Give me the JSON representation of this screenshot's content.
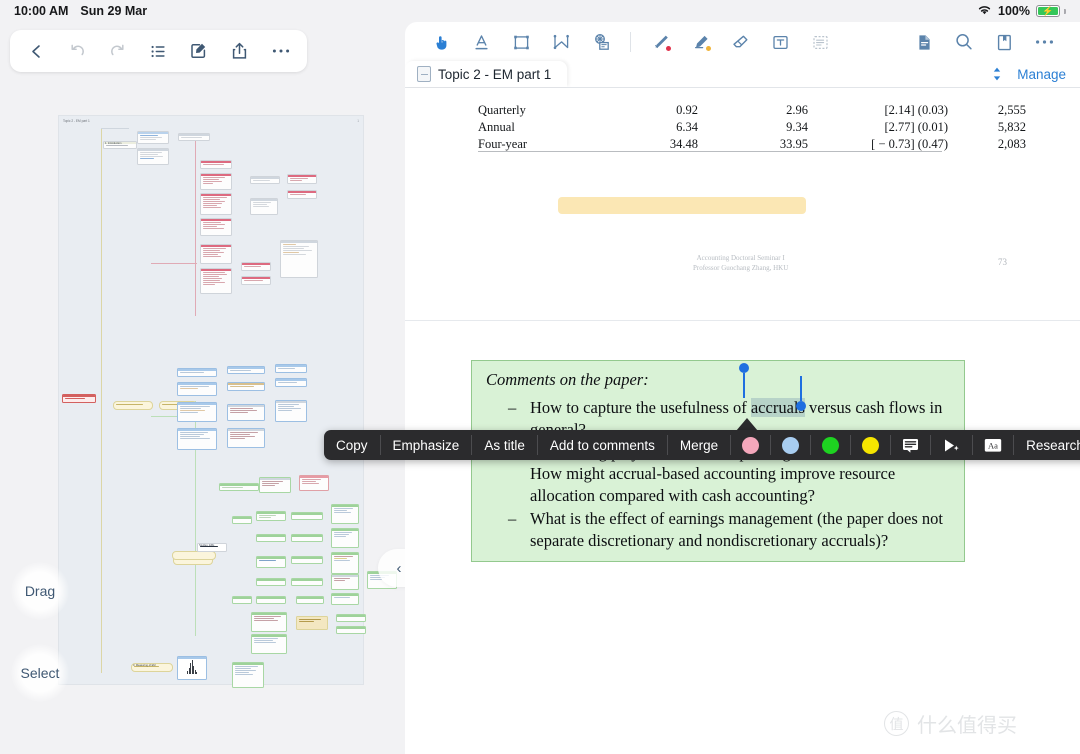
{
  "status_bar": {
    "time": "10:00 AM",
    "date": "Sun 29 Mar",
    "battery_percent": "100%",
    "wifi_icon": "wifi-icon",
    "battery_icon": "battery-charging-icon"
  },
  "left_pane": {
    "toolbar": [
      {
        "name": "back-button",
        "icon": "chevron-left-icon",
        "enabled": true
      },
      {
        "name": "undo-button",
        "icon": "undo-icon",
        "enabled": false
      },
      {
        "name": "redo-button",
        "icon": "redo-icon",
        "enabled": false
      },
      {
        "name": "outline-button",
        "icon": "list-icon",
        "enabled": true
      },
      {
        "name": "edit-button",
        "icon": "edit-square-icon",
        "enabled": true
      },
      {
        "name": "share-button",
        "icon": "share-icon",
        "enabled": true
      },
      {
        "name": "more-button",
        "icon": "ellipsis-icon",
        "enabled": true
      }
    ],
    "mindmap": {
      "title": "Topic 2 - EM part 1",
      "corner": "1",
      "node_labels": [
        "1. Introduction",
        "Earnings Management (EM)",
        "Chapter 1: What is EM",
        "How to do earnings mgmt",
        "Studies: EMs",
        "3. Measuring of EM"
      ],
      "accent_red": "#d9566b",
      "accent_yellow": "#e3c75a",
      "accent_blue": "#7aa8d8",
      "accent_green": "#8ed08a",
      "canvas_bg": "#e9edf2"
    },
    "drag_button": "Drag",
    "select_button": "Select",
    "page_nav": {
      "prev": "‹",
      "next": "›"
    }
  },
  "right_pane": {
    "toolbar_left": [
      {
        "name": "select-tool",
        "icon": "hand-pointer-icon",
        "state": "active"
      },
      {
        "name": "underline-tool",
        "icon": "underline-a-icon",
        "state": "normal"
      },
      {
        "name": "area-tool",
        "icon": "crop-frame-icon",
        "state": "normal"
      },
      {
        "name": "shape-tool",
        "icon": "polyline-icon",
        "state": "normal"
      },
      {
        "name": "stamp-tool",
        "icon": "stamp-icon",
        "state": "normal"
      },
      {
        "name": "pen-tool",
        "icon": "pen-icon",
        "state": "normal",
        "dot": "#e0324b"
      },
      {
        "name": "highlighter-tool",
        "icon": "highlighter-icon",
        "state": "normal",
        "dot": "#f0b43a"
      },
      {
        "name": "eraser-tool",
        "icon": "eraser-icon",
        "state": "normal"
      },
      {
        "name": "text-box-tool",
        "icon": "text-box-icon",
        "state": "normal"
      },
      {
        "name": "snippet-tool",
        "icon": "dashed-list-icon",
        "state": "muted"
      }
    ],
    "toolbar_right": [
      {
        "name": "page-view-button",
        "icon": "document-icon"
      },
      {
        "name": "search-button",
        "icon": "search-icon"
      },
      {
        "name": "bookmark-button",
        "icon": "bookmark-icon"
      },
      {
        "name": "more-button",
        "icon": "ellipsis-icon"
      }
    ],
    "tab": {
      "label": "Topic 2 - EM part 1",
      "icon": "pdf-file-icon"
    },
    "tabbar_right": {
      "sort_icon": "sort-updown-icon",
      "manage_label": "Manage"
    },
    "document": {
      "table": {
        "rows": [
          {
            "label": "Quarterly",
            "c1": "0.92",
            "c2": "2.96",
            "c3": "[2.14] (0.03)",
            "c4": "2,555"
          },
          {
            "label": "Annual",
            "c1": "6.34",
            "c2": "9.34",
            "c3": "[2.77] (0.01)",
            "c4": "5,832"
          },
          {
            "label": "Four-year",
            "c1": "34.48",
            "c2": "33.95",
            "c3": "[ − 0.73] (0.47)",
            "c4": "2,083"
          }
        ]
      },
      "highlight_bar_color": "#fbe7b4",
      "footer_line1": "Accounting Doctoral Seminar I",
      "footer_line2": "Professor Guochang Zhang, HKU",
      "page_number": "73"
    },
    "comment_block": {
      "title": "Comments on the paper:",
      "bg_color": "#d9f2d6",
      "border_color": "#93c98e",
      "items": [
        {
          "dash": "–",
          "text_before": "How to capture the usefulness of ",
          "selected": "accruals",
          "text_after": " versus cash flows in general?"
        },
        {
          "dash": "–",
          "text_before": "Accounting plays the role of improving resource allocation. How might accrual-based accounting improve resource allocation compared with cash accounting?",
          "selected": "",
          "text_after": ""
        },
        {
          "dash": "–",
          "text_before": "What is the effect of earnings management (the paper does not separate discretionary and nondiscretionary accruals)?",
          "selected": "",
          "text_after": ""
        }
      ]
    },
    "context_menu": {
      "items": [
        {
          "name": "copy-menu-item",
          "label": "Copy",
          "type": "text"
        },
        {
          "name": "emphasize-menu-item",
          "label": "Emphasize",
          "type": "text"
        },
        {
          "name": "as-title-menu-item",
          "label": "As title",
          "type": "text"
        },
        {
          "name": "add-to-comments-menu-item",
          "label": "Add to comments",
          "type": "text"
        },
        {
          "name": "merge-menu-item",
          "label": "Merge",
          "type": "text"
        },
        {
          "name": "color-pink-swatch",
          "label": "",
          "type": "color",
          "color": "#f4a7bb"
        },
        {
          "name": "color-blue-swatch",
          "label": "",
          "type": "color",
          "color": "#a8cdf0"
        },
        {
          "name": "color-green-swatch",
          "label": "",
          "type": "color",
          "color": "#1ed321"
        },
        {
          "name": "color-yellow-swatch",
          "label": "",
          "type": "color",
          "color": "#f5e500"
        },
        {
          "name": "note-menu-item",
          "label": "",
          "type": "icon",
          "icon": "note-lines-icon"
        },
        {
          "name": "play-menu-item",
          "label": "",
          "type": "icon",
          "icon": "play-sparkle-icon"
        },
        {
          "name": "translate-menu-item",
          "label": "",
          "type": "icon",
          "icon": "translate-aa-icon"
        },
        {
          "name": "research-menu-item",
          "label": "Research",
          "type": "text"
        },
        {
          "name": "share-menu-item",
          "label": "",
          "type": "icon",
          "icon": "share-icon"
        }
      ]
    }
  },
  "watermark": {
    "mark": "值",
    "text": "什么值得买"
  }
}
